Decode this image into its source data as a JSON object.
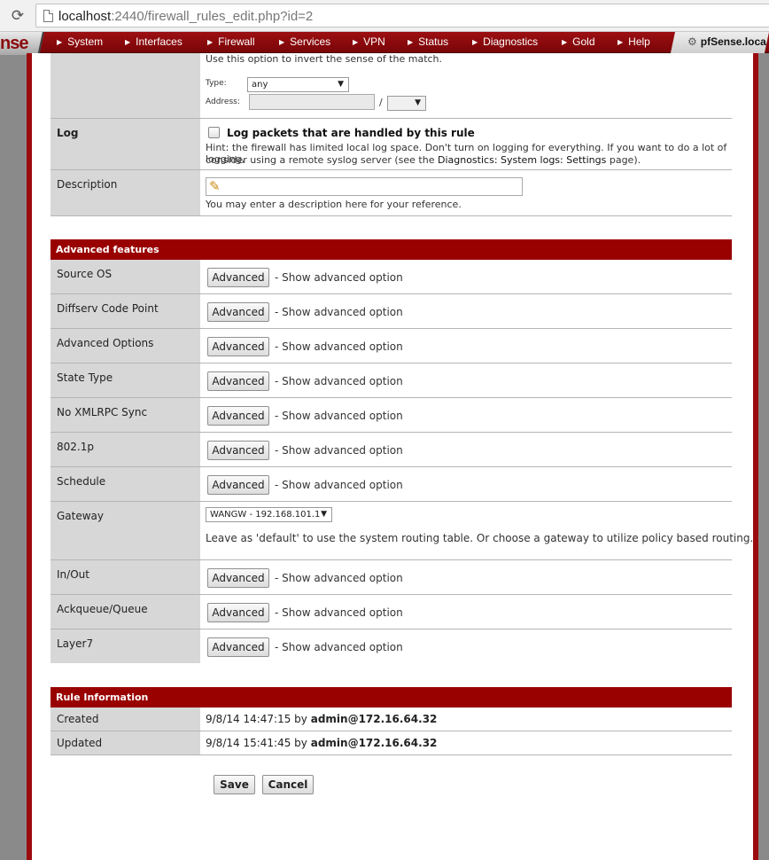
{
  "browser": {
    "url_host": "localhost",
    "url_rest": ":2440/firewall_rules_edit.php?id=2"
  },
  "nav": {
    "logo": "nse",
    "items": [
      "System",
      "Interfaces",
      "Firewall",
      "Services",
      "VPN",
      "Status",
      "Diagnostics",
      "Gold",
      "Help"
    ],
    "host": "pfSense.loca"
  },
  "source_section": {
    "invert_hint": "Use this option to invert the sense of the match.",
    "type_label": "Type:",
    "type_value": "any",
    "address_label": "Address:",
    "slash": "/"
  },
  "log": {
    "label": "Log",
    "checkbox_label": "Log packets that are handled by this rule",
    "hint_line1": "Hint: the firewall has limited local log space. Don't turn on logging for everything. If you want to do a lot of logging,",
    "hint_line2_pre": "consider using a remote syslog server (see the ",
    "hint_link": "Diagnostics: System logs: Settings",
    "hint_line2_post": " page)."
  },
  "description": {
    "label": "Description",
    "hint": "You may enter a description here for your reference."
  },
  "advanced": {
    "title": "Advanced features",
    "button_label": "Advanced",
    "show_text": "- Show advanced option",
    "rows": [
      {
        "label": "Source OS"
      },
      {
        "label": "Diffserv Code Point"
      },
      {
        "label": "Advanced Options"
      },
      {
        "label": "State Type"
      },
      {
        "label": "No XMLRPC Sync"
      },
      {
        "label": "802.1p"
      },
      {
        "label": "Schedule"
      }
    ],
    "gateway": {
      "label": "Gateway",
      "value": "WANGW - 192.168.101.1",
      "hint": "Leave as 'default' to use the system routing table. Or choose a gateway to utilize policy based routing."
    },
    "rows2": [
      {
        "label": "In/Out"
      },
      {
        "label": "Ackqueue/Queue"
      },
      {
        "label": "Layer7"
      }
    ]
  },
  "rule_info": {
    "title": "Rule Information",
    "created_label": "Created",
    "created_time": "9/8/14 14:47:15",
    "updated_label": "Updated",
    "updated_time": "9/8/14 15:41:45",
    "by": "by",
    "user": "admin@172.16.64.32"
  },
  "buttons": {
    "save": "Save",
    "cancel": "Cancel"
  }
}
